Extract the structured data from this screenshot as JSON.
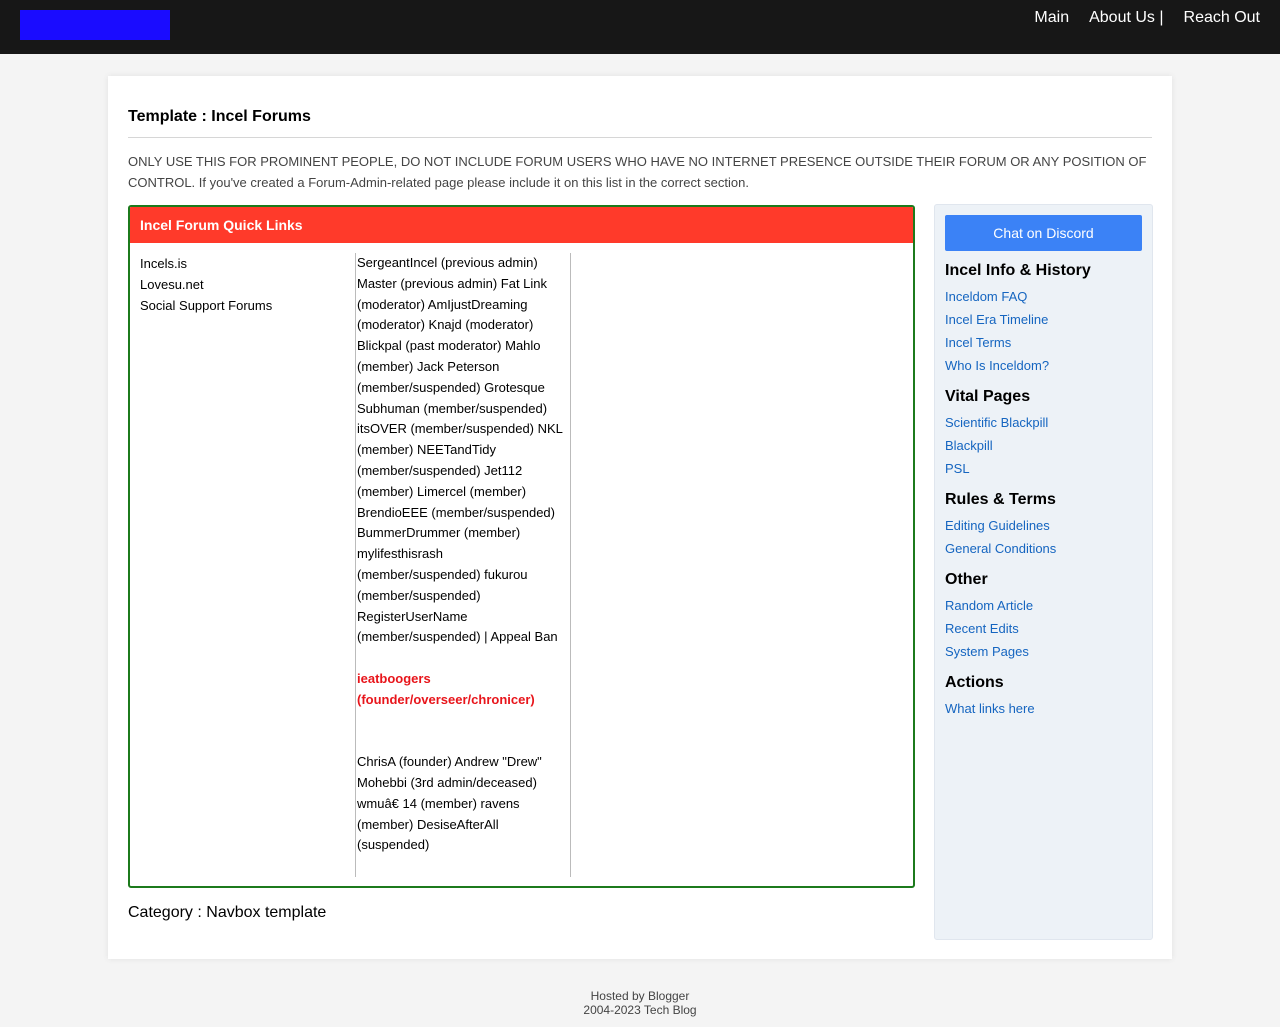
{
  "header": {
    "logo_color": "#1a0cff",
    "nav": [
      "Main",
      "About Us |",
      "Reach Out"
    ]
  },
  "page": {
    "title": "Template : Incel Forums",
    "notice": "ONLY USE THIS FOR PROMINENT PEOPLE, DO NOT INCLUDE FORUM USERS WHO HAVE NO INTERNET PRESENCE OUTSIDE THEIR FORUM OR ANY POSITION OF CONTROL. If you've created a Forum-Admin-related page please include it on this list in the correct section.",
    "category": "Category : Navbox template"
  },
  "navbox": {
    "title": "Incel Forum Quick Links",
    "header_color": "#ff3a2a",
    "border_color": "#1c7a1c",
    "forums": [
      "Incels.is",
      "Lovesu.net",
      "Social Support Forums"
    ],
    "members_text": "SergeantIncel (previous admin) Master (previous admin) Fat Link (moderator) AmIjustDreaming (moderator) Knajd (moderator) Blickpal (past moderator) Mahlo (member) Jack Peterson (member/suspended) Grotesque Subhuman (member/suspended) itsOVER (member/suspended) NKL (member) NEETandTidy (member/suspended) Jet112 (member) Limercel (member) BrendioEEE (member/suspended) BummerDrummer (member) mylifesthisrash (member/suspended) fukurou (member/suspended) RegisterUserName (member/suspended) | Appeal Ban",
    "founder_text": "ieatboogers (founder/overseer/chronicer)",
    "founder_color": "#e8151b",
    "others_text": "ChrisA (founder) Andrew \"Drew\" Mohebbi (3rd admin/deceased) wmuâ€ 14 (member) ravens (member) DesiseAfterAll (suspended)"
  },
  "sidebar": {
    "discord_label": "Chat on Discord",
    "sections": [
      {
        "title": "Incel Info & History",
        "links": [
          "Inceldom FAQ",
          "Incel Era Timeline",
          "Incel Terms",
          "Who Is Inceldom?"
        ]
      },
      {
        "title": "Vital Pages",
        "links": [
          "Scientific Blackpill",
          "Blackpill",
          "PSL"
        ]
      },
      {
        "title": "Rules & Terms",
        "links": [
          "Editing Guidelines",
          "General Conditions"
        ]
      },
      {
        "title": "Other",
        "links": [
          "Random Article",
          "Recent Edits",
          "System Pages"
        ]
      },
      {
        "title": "Actions",
        "links": [
          "What links here"
        ]
      }
    ]
  },
  "footer": {
    "line1": "Hosted by Blogger",
    "line2": "2004-2023 Tech Blog"
  }
}
